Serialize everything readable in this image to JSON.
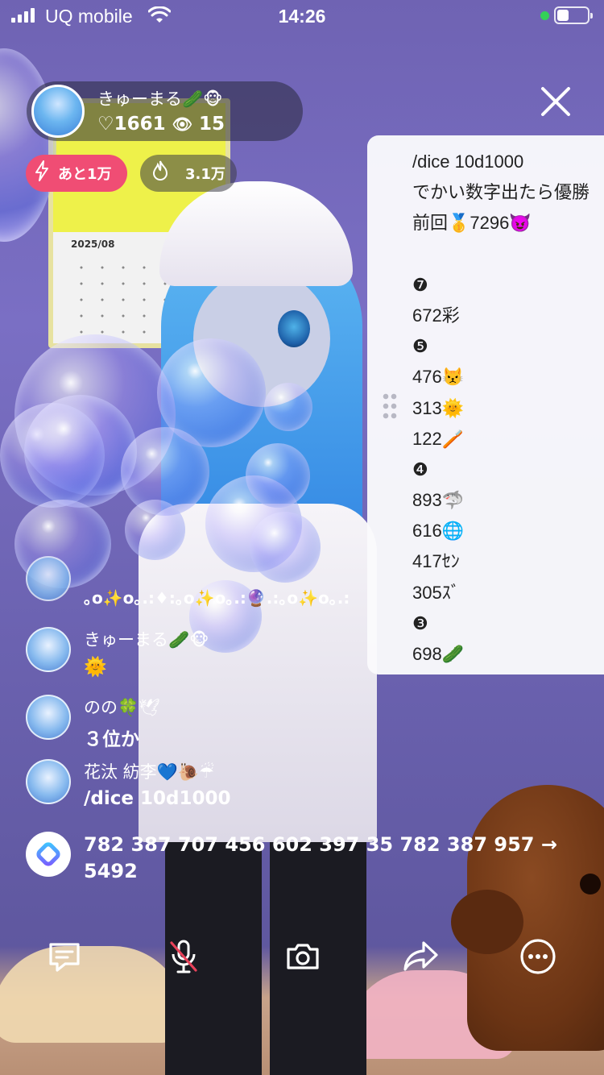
{
  "status_bar": {
    "carrier": "UQ mobile",
    "time": "14:26"
  },
  "background": {
    "calendar_month": "2025/08"
  },
  "host": {
    "name": "きゅーまる🥒🐵",
    "likes": "♡1661",
    "viewers": "15"
  },
  "boost": {
    "label": "あと1万"
  },
  "heat": {
    "label": "3.1万"
  },
  "side_panel": {
    "lines": [
      "/dice 10d1000",
      "でかい数字出たら優勝",
      "前回🥇7296😈",
      "",
      "❼",
      "672彩",
      "❺",
      "476😾",
      "313🌞",
      "122🪥",
      "❹",
      "893🦈",
      "616🌐",
      "417ｾﾝ",
      "305ｽﾞ",
      "❸",
      "698🥒"
    ]
  },
  "comments": [
    {
      "name": "",
      "text": "｡o✨o｡.:♦:｡o✨o｡.:🔮.:｡o✨o｡.:"
    },
    {
      "name": "きゅーまる🥒🐵",
      "text": "🌞"
    },
    {
      "name": "のの🍀🕊",
      "text": "３位か"
    },
    {
      "name": "花汰 紡李💙🐌☔",
      "text": "/dice 10d1000"
    }
  ],
  "system_message": {
    "text": "782 387 707 456 602 397 35 782 387 957 → 5492"
  },
  "colors": {
    "boost_pink": "#f04d74",
    "panel_bg": "#fafafc",
    "online_green": "#34d058"
  },
  "bottom_bar": {
    "icons": [
      "comment-icon",
      "mic-muted-icon",
      "camera-icon",
      "share-icon",
      "more-icon"
    ]
  }
}
